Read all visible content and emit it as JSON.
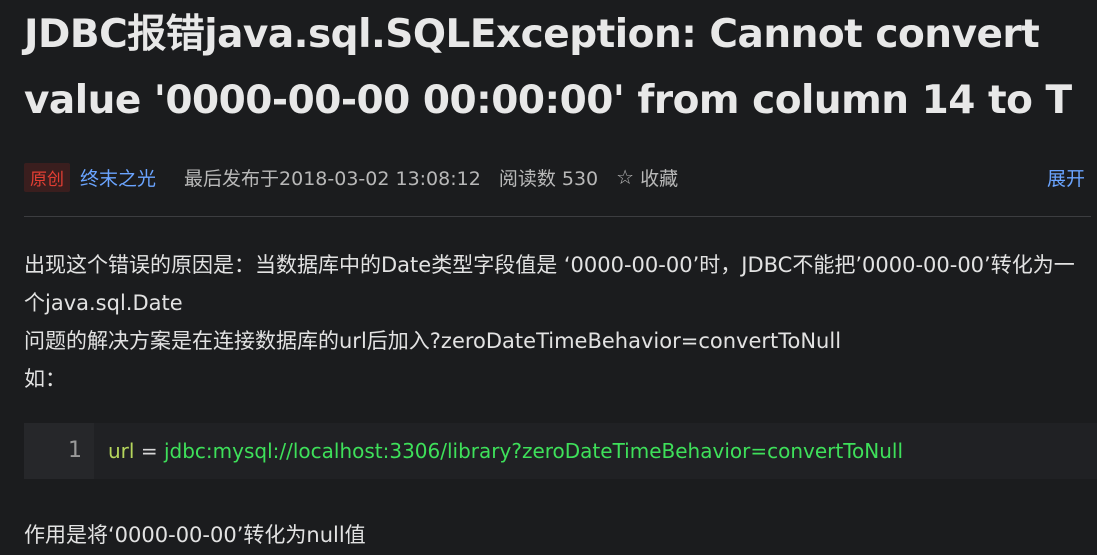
{
  "article": {
    "title": "JDBC报错java.sql.SQLException: Cannot convert value '0000-00-00 00:00:00' from column 14 to T",
    "meta": {
      "badge": "原创",
      "author": "终末之光",
      "published": "最后发布于2018-03-02 13:08:12",
      "reads": "阅读数 530",
      "favorite_label": "收藏",
      "expand_label": "展开"
    },
    "paragraphs": [
      "出现这个错误的原因是：当数据库中的Date类型字段值是 ‘0000-00-00’时，JDBC不能把’0000-00-00’转化为一个java.sql.Date",
      "问题的解决方案是在连接数据库的url后加入?zeroDateTimeBehavior=convertToNull",
      "如："
    ],
    "code": {
      "line_number": "1",
      "var": "url",
      "op": " = ",
      "value": "jdbc:mysql://localhost:3306/library?zeroDateTimeBehavior=convertToNull"
    },
    "after_code": "作用是将‘0000-00-00’转化为null值"
  },
  "colors": {
    "background": "#1b1c1e",
    "link": "#6aa4ff",
    "badge": "#e33e33",
    "code_string": "#3ee05a"
  },
  "icons": {
    "favorite": "star-outline-icon"
  }
}
